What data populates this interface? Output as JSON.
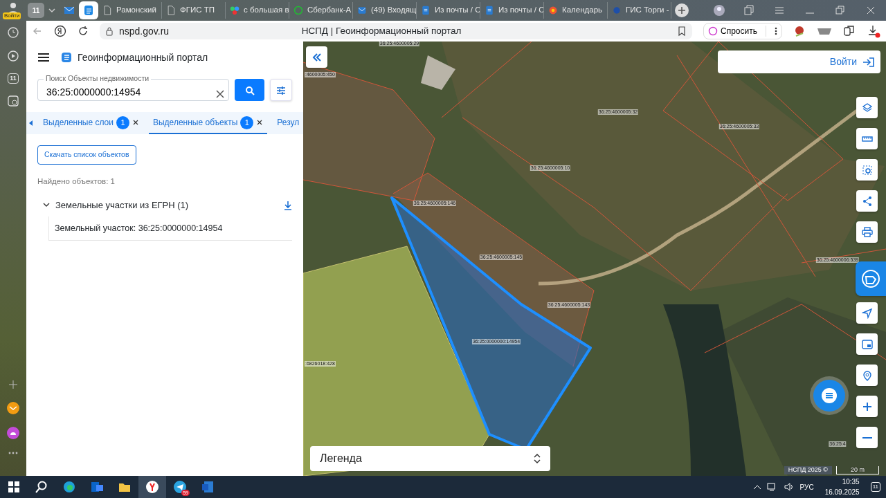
{
  "browser": {
    "profile_label": "Войти",
    "tab_count": "11",
    "tabs": [
      {
        "kind": "pinned",
        "selected": false
      },
      {
        "kind": "pinned",
        "selected": true
      },
      {
        "kind": "page",
        "title": "Рамонский",
        "selected": false
      },
      {
        "kind": "page",
        "title": "ФГИС ТП",
        "selected": false
      },
      {
        "kind": "page",
        "title": "с большая в",
        "selected": false
      },
      {
        "kind": "page",
        "title": "Сбербанк-А",
        "selected": false
      },
      {
        "kind": "page",
        "title": "(49) Входящ",
        "selected": false
      },
      {
        "kind": "page",
        "title": "Из почты / С",
        "selected": false
      },
      {
        "kind": "page",
        "title": "Из почты / С",
        "selected": false
      },
      {
        "kind": "page",
        "title": "Календарь",
        "selected": false
      },
      {
        "kind": "page",
        "title": "ГИС Торги -",
        "selected": false
      }
    ],
    "address": "nspd.gov.ru",
    "page_title": "НСПД | Геоинформационный портал",
    "ask_button": "Спросить",
    "side_counter": "11"
  },
  "app": {
    "title": "Геоинформационный портал",
    "search": {
      "label": "Поиск Объекты недвижимости",
      "value": "36:25:0000000:14954"
    },
    "tabs": [
      {
        "label": "Выделенные слои",
        "count": "1",
        "selected": false
      },
      {
        "label": "Выделенные объекты",
        "count": "1",
        "selected": true
      },
      {
        "label": "Резул",
        "selected": false
      }
    ],
    "download_button": "Скачать список объектов",
    "found": "Найдено объектов: 1",
    "groups": [
      {
        "label": "Земельные участки из ЕГРН (1)",
        "expanded": true,
        "children": [
          {
            "label": "Земельный участок: 36:25:0000000:14954"
          }
        ]
      }
    ]
  },
  "map": {
    "login": "Войти",
    "parcel_labels": [
      "36:25:4600005:29",
      ":4600005:450",
      "36:25:4600005:32",
      "36:25:4600005:33",
      "36:25:4600005:10",
      "36:25:4600005:146",
      "36:25:4600005:145",
      "36:25:4600005:143",
      "36:25:4600006:539",
      "36:25:0000000:14954",
      ":6826018:428",
      "36:25:4"
    ],
    "legend": "Легенда",
    "attribution": "НСПД 2025 ©",
    "scale": "20 m"
  },
  "taskbar": {
    "telegram_badge": "59",
    "language": "РУС",
    "time": "10:35",
    "date": "16.09.2025",
    "notifications": "11"
  }
}
